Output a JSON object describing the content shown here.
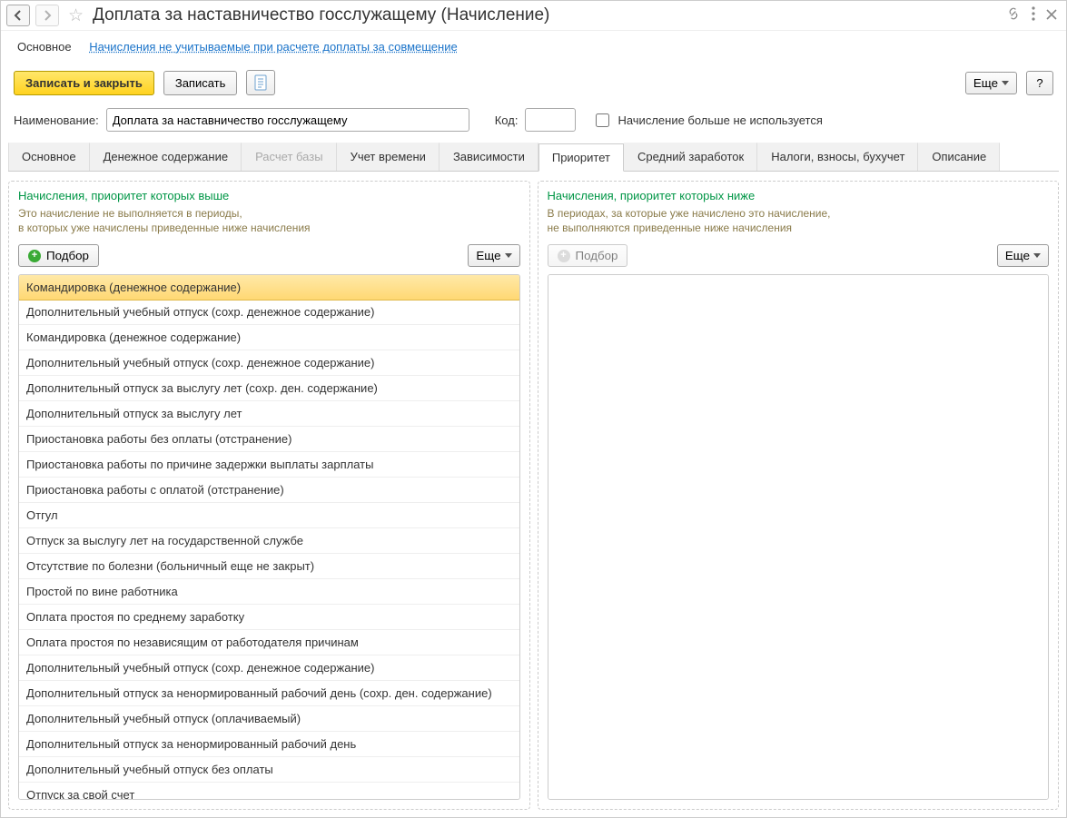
{
  "title": "Доплата за наставничество госслужащему (Начисление)",
  "nav": {
    "current": "Основное",
    "link": "Начисления не учитываемые при расчете доплаты за совмещение"
  },
  "toolbar": {
    "save_close": "Записать и закрыть",
    "save": "Записать",
    "more": "Еще",
    "help": "?"
  },
  "form": {
    "name_label": "Наименование:",
    "name_value": "Доплата за наставничество госслужащему",
    "code_label": "Код:",
    "code_value": "",
    "unused_label": "Начисление больше не используется"
  },
  "tabs": [
    {
      "label": "Основное",
      "active": false,
      "disabled": false
    },
    {
      "label": "Денежное содержание",
      "active": false,
      "disabled": false
    },
    {
      "label": "Расчет базы",
      "active": false,
      "disabled": true
    },
    {
      "label": "Учет времени",
      "active": false,
      "disabled": false
    },
    {
      "label": "Зависимости",
      "active": false,
      "disabled": false
    },
    {
      "label": "Приоритет",
      "active": true,
      "disabled": false
    },
    {
      "label": "Средний заработок",
      "active": false,
      "disabled": false
    },
    {
      "label": "Налоги, взносы, бухучет",
      "active": false,
      "disabled": false
    },
    {
      "label": "Описание",
      "active": false,
      "disabled": false
    }
  ],
  "left": {
    "title": "Начисления, приоритет которых выше",
    "desc1": "Это начисление не выполняется в периоды,",
    "desc2": "в которых уже начислены приведенные ниже начисления",
    "pick": "Подбор",
    "more": "Еще",
    "items": [
      "Командировка (денежное содержание)",
      "Дополнительный учебный отпуск (сохр. денежное содержание)",
      "Командировка (денежное содержание)",
      "Дополнительный учебный отпуск (сохр. денежное содержание)",
      "Дополнительный отпуск за выслугу лет (сохр. ден. содержание)",
      "Дополнительный отпуск за выслугу лет",
      "Приостановка работы без оплаты (отстранение)",
      "Приостановка работы по причине задержки выплаты зарплаты",
      "Приостановка работы с оплатой (отстранение)",
      "Отгул",
      "Отпуск за выслугу лет на государственной службе",
      "Отсутствие по болезни (больничный еще не закрыт)",
      "Простой по вине работника",
      "Оплата простоя по среднему заработку",
      "Оплата простоя по независящим от работодателя причинам",
      "Дополнительный учебный отпуск (сохр. денежное содержание)",
      "Дополнительный отпуск за ненормированный рабочий день (сохр. ден. содержание)",
      "Дополнительный учебный отпуск (оплачиваемый)",
      "Дополнительный отпуск за ненормированный рабочий день",
      "Дополнительный учебный отпуск без оплаты",
      "Отпуск за свой счет"
    ]
  },
  "right": {
    "title": "Начисления, приоритет которых ниже",
    "desc1": "В периодах, за которые уже начислено это начисление,",
    "desc2": "не выполняются приведенные ниже начисления",
    "pick": "Подбор",
    "more": "Еще"
  }
}
